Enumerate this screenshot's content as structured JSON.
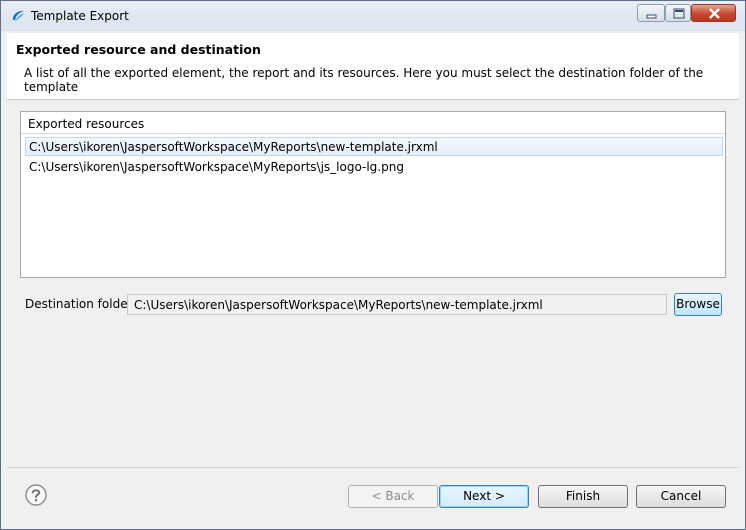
{
  "window": {
    "title": "Template Export"
  },
  "header": {
    "title": "Exported resource and destination",
    "description": "A list of all the exported element, the report and its resources. Here you must select the destination folder of the template"
  },
  "resources": {
    "column_header": "Exported resources",
    "items": [
      "C:\\Users\\ikoren\\JaspersoftWorkspace\\MyReports\\new-template.jrxml",
      "C:\\Users\\ikoren\\JaspersoftWorkspace\\MyReports\\js_logo-lg.png"
    ]
  },
  "destination": {
    "label": "Destination folder:",
    "value": "C:\\Users\\ikoren\\JaspersoftWorkspace\\MyReports\\new-template.jrxml",
    "browse_label": "Browse"
  },
  "footer": {
    "back_label": "< Back",
    "next_label": "Next >",
    "finish_label": "Finish",
    "cancel_label": "Cancel"
  },
  "icons": {
    "app": "jaspersoft-app-icon",
    "help": "help-icon",
    "minimize": "minimize-icon",
    "maximize": "maximize-icon",
    "close": "close-icon"
  },
  "colors": {
    "selection": "#e4edf9",
    "close_button": "#c8482f",
    "default_button_border": "#3c7fb1"
  }
}
